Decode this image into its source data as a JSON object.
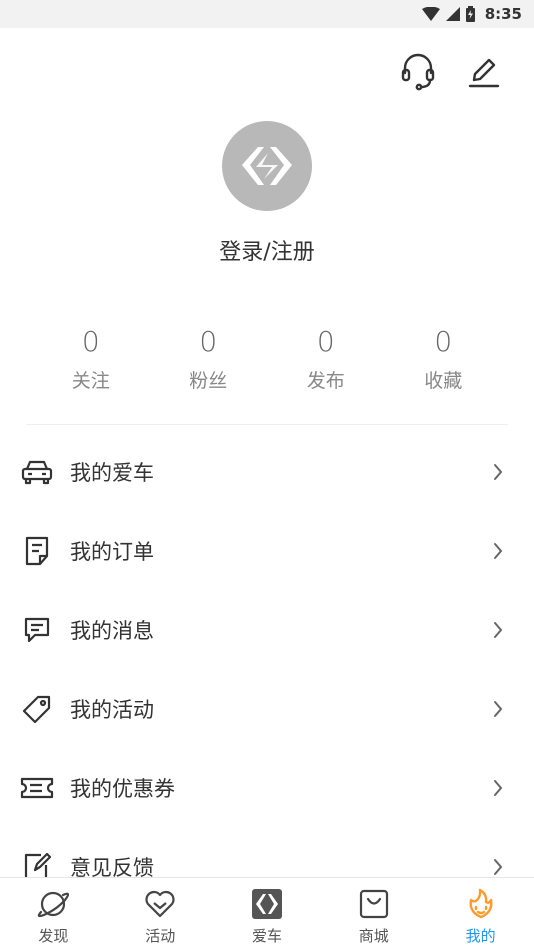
{
  "status_bar": {
    "time": "8:35"
  },
  "profile": {
    "login_label": "登录/注册"
  },
  "stats": [
    {
      "count": "0",
      "label": "关注"
    },
    {
      "count": "0",
      "label": "粉丝"
    },
    {
      "count": "0",
      "label": "发布"
    },
    {
      "count": "0",
      "label": "收藏"
    }
  ],
  "menu": [
    {
      "label": "我的爱车",
      "icon": "car-icon"
    },
    {
      "label": "我的订单",
      "icon": "order-icon"
    },
    {
      "label": "我的消息",
      "icon": "message-icon"
    },
    {
      "label": "我的活动",
      "icon": "tag-icon"
    },
    {
      "label": "我的优惠券",
      "icon": "coupon-icon"
    },
    {
      "label": "意见反馈",
      "icon": "feedback-icon"
    }
  ],
  "tabs": [
    {
      "label": "发现",
      "icon": "planet-icon"
    },
    {
      "label": "活动",
      "icon": "heart-icon"
    },
    {
      "label": "爱车",
      "icon": "brand-logo-icon"
    },
    {
      "label": "商城",
      "icon": "shopping-bag-icon"
    },
    {
      "label": "我的",
      "icon": "flame-face-icon",
      "active": true
    }
  ],
  "colors": {
    "accent": "#2196f3",
    "active_icon": "#ff9a2e",
    "avatar_bg": "#b8b8b8",
    "status_bg": "#f2f2f2"
  }
}
